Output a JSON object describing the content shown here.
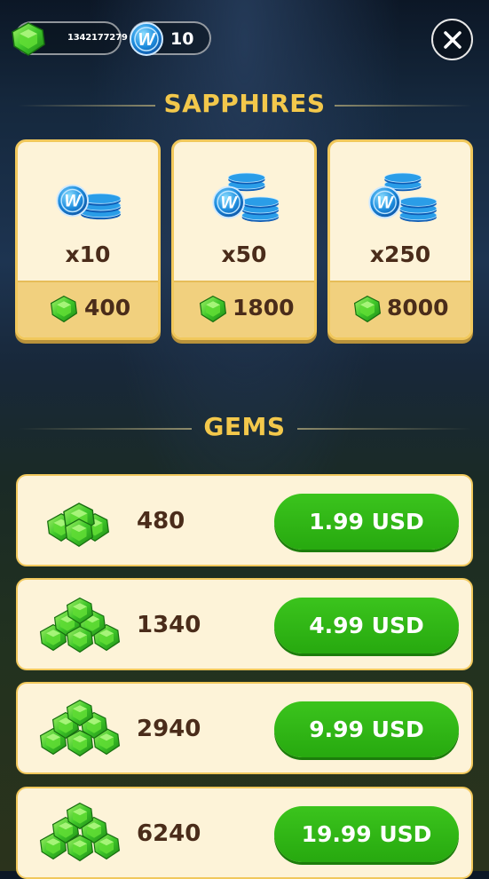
{
  "header": {
    "gem_balance": "1342177279",
    "sapphire_balance": "10",
    "close_icon": "close-icon"
  },
  "sapphires": {
    "title": "SAPPHIRES",
    "packs": [
      {
        "qty": "x10",
        "price": "400"
      },
      {
        "qty": "x50",
        "price": "1800"
      },
      {
        "qty": "x250",
        "price": "8000"
      }
    ]
  },
  "gems": {
    "title": "GEMS",
    "offers": [
      {
        "amount": "480",
        "price": "1.99 USD"
      },
      {
        "amount": "1340",
        "price": "4.99 USD"
      },
      {
        "amount": "2940",
        "price": "9.99 USD"
      },
      {
        "amount": "6240",
        "price": "19.99 USD"
      }
    ]
  },
  "colors": {
    "accent_gold": "#f3c84b",
    "card_bg": "#fdf3d8",
    "buy_green": "#2fb816",
    "text_brown": "#4a2c1a"
  }
}
